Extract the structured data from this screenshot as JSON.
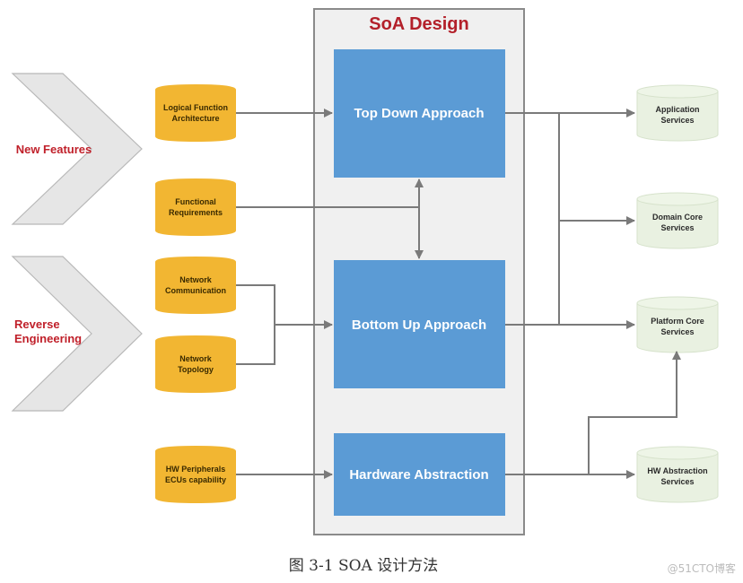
{
  "diagram": {
    "title": "SoA Design",
    "sources": [
      {
        "id": "new-features",
        "label_lines": [
          "New Features"
        ]
      },
      {
        "id": "reverse-engineering",
        "label_lines": [
          "Reverse",
          "Engineering"
        ]
      }
    ],
    "inputs": [
      {
        "id": "logical-function-architecture",
        "label_lines": [
          "Logical Function",
          "Architecture"
        ]
      },
      {
        "id": "functional-requirements",
        "label_lines": [
          "Functional",
          "Requirements"
        ]
      },
      {
        "id": "network-communication",
        "label_lines": [
          "Network",
          "Communication"
        ]
      },
      {
        "id": "network-topology",
        "label_lines": [
          "Network",
          "Topology"
        ]
      },
      {
        "id": "hw-peripherals-ecus",
        "label_lines": [
          "HW Peripherals",
          "ECUs capability"
        ]
      }
    ],
    "approaches": [
      {
        "id": "top-down-approach",
        "label": "Top Down Approach"
      },
      {
        "id": "bottom-up-approach",
        "label": "Bottom Up Approach"
      },
      {
        "id": "hardware-abstraction",
        "label": "Hardware Abstraction"
      }
    ],
    "services": [
      {
        "id": "application-services",
        "label_lines": [
          "Application",
          "Services"
        ]
      },
      {
        "id": "domain-core-services",
        "label_lines": [
          "Domain Core",
          "Services"
        ]
      },
      {
        "id": "platform-core-services",
        "label_lines": [
          "Platform Core",
          "Services"
        ]
      },
      {
        "id": "hw-abstraction-services",
        "label_lines": [
          "HW Abstraction",
          "Services"
        ]
      }
    ],
    "edges": [
      {
        "from": "logical-function-architecture",
        "to": "top-down-approach"
      },
      {
        "from": "functional-requirements",
        "to": "top-down-approach"
      },
      {
        "from": "functional-requirements",
        "to": "bottom-up-approach"
      },
      {
        "from": "network-communication",
        "to": "bottom-up-approach"
      },
      {
        "from": "network-topology",
        "to": "bottom-up-approach"
      },
      {
        "from": "hw-peripherals-ecus",
        "to": "hardware-abstraction"
      },
      {
        "from": "top-down-approach",
        "to": "application-services"
      },
      {
        "from": "top-down-approach",
        "to": "domain-core-services"
      },
      {
        "from": "bottom-up-approach",
        "to": "domain-core-services"
      },
      {
        "from": "bottom-up-approach",
        "to": "platform-core-services"
      },
      {
        "from": "hardware-abstraction",
        "to": "platform-core-services"
      },
      {
        "from": "hardware-abstraction",
        "to": "hw-abstraction-services"
      }
    ],
    "colors": {
      "source_label": "#c0202a",
      "input_fill": "#f2b632",
      "approach_fill": "#5b9bd5",
      "service_fill": "#e9f1e1",
      "title": "#b3202a"
    }
  },
  "caption": "图 3-1   SOA 设计方法",
  "watermark": "@51CTO博客"
}
